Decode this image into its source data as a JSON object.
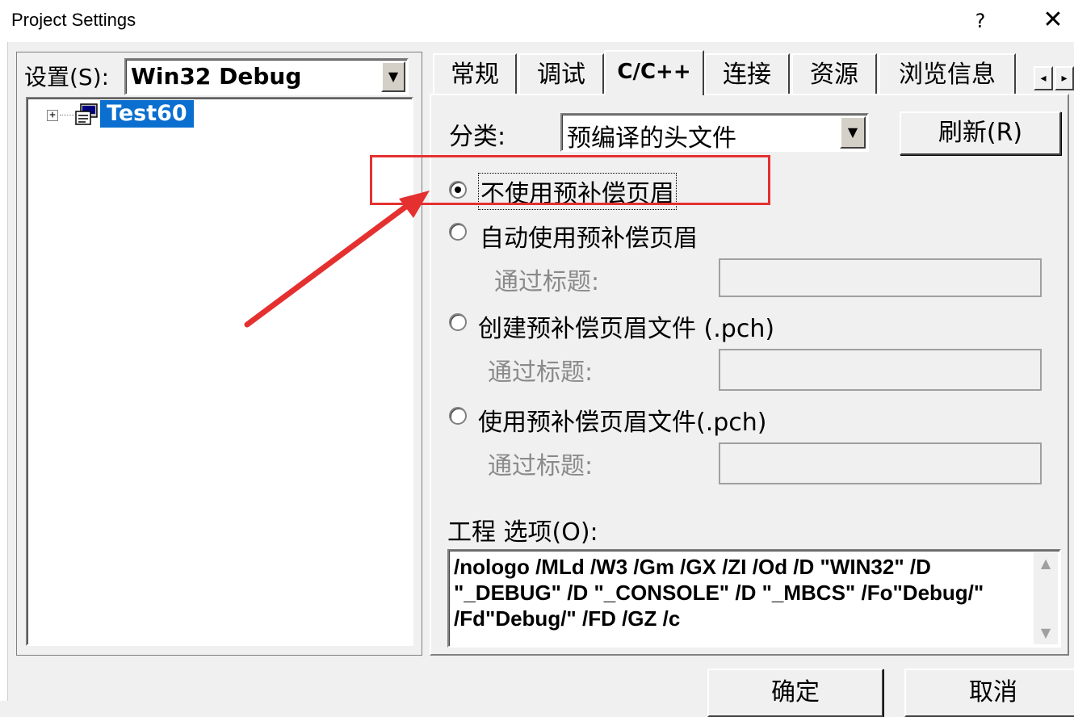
{
  "window": {
    "title": "Project Settings",
    "help_glyph": "?",
    "close_glyph": "✕"
  },
  "left": {
    "settings_label": "设置(S):",
    "config_value": "Win32 Debug",
    "tree": {
      "expander": "+",
      "item": "Test60"
    }
  },
  "tabs": [
    {
      "label": "常规",
      "active": false
    },
    {
      "label": "调试",
      "active": false
    },
    {
      "label": "C/C++",
      "active": true
    },
    {
      "label": "连接",
      "active": false
    },
    {
      "label": "资源",
      "active": false
    },
    {
      "label": "浏览信息",
      "active": false
    }
  ],
  "tab_scroll": {
    "left": "◂",
    "right": "▸"
  },
  "category": {
    "label": "分类:",
    "value": "预编译的头文件"
  },
  "refresh_button": "刷新(R)",
  "radios": [
    {
      "label": "不使用预补偿页眉",
      "checked": true
    },
    {
      "label": "自动使用预补偿页眉",
      "checked": false
    },
    {
      "label": "创建预补偿页眉文件 (.pch)",
      "checked": false
    },
    {
      "label": "使用预补偿页眉文件(.pch)",
      "checked": false
    }
  ],
  "through_header_label": "通过标题:",
  "project_options": {
    "label": "工程 选项(O):",
    "text": "/nologo /MLd /W3 /Gm /GX /ZI /Od /D \"WIN32\" /D \"_DEBUG\" /D \"_CONSOLE\" /D \"_MBCS\" /Fo\"Debug/\" /Fd\"Debug/\" /FD /GZ  /c"
  },
  "buttons": {
    "ok": "确定",
    "cancel": "取消"
  },
  "colors": {
    "annotation": "#e53030",
    "selection": "#0a6fcf"
  },
  "icons": {
    "dropdown": "▼",
    "scroll_up": "▲",
    "scroll_down": "▼"
  }
}
